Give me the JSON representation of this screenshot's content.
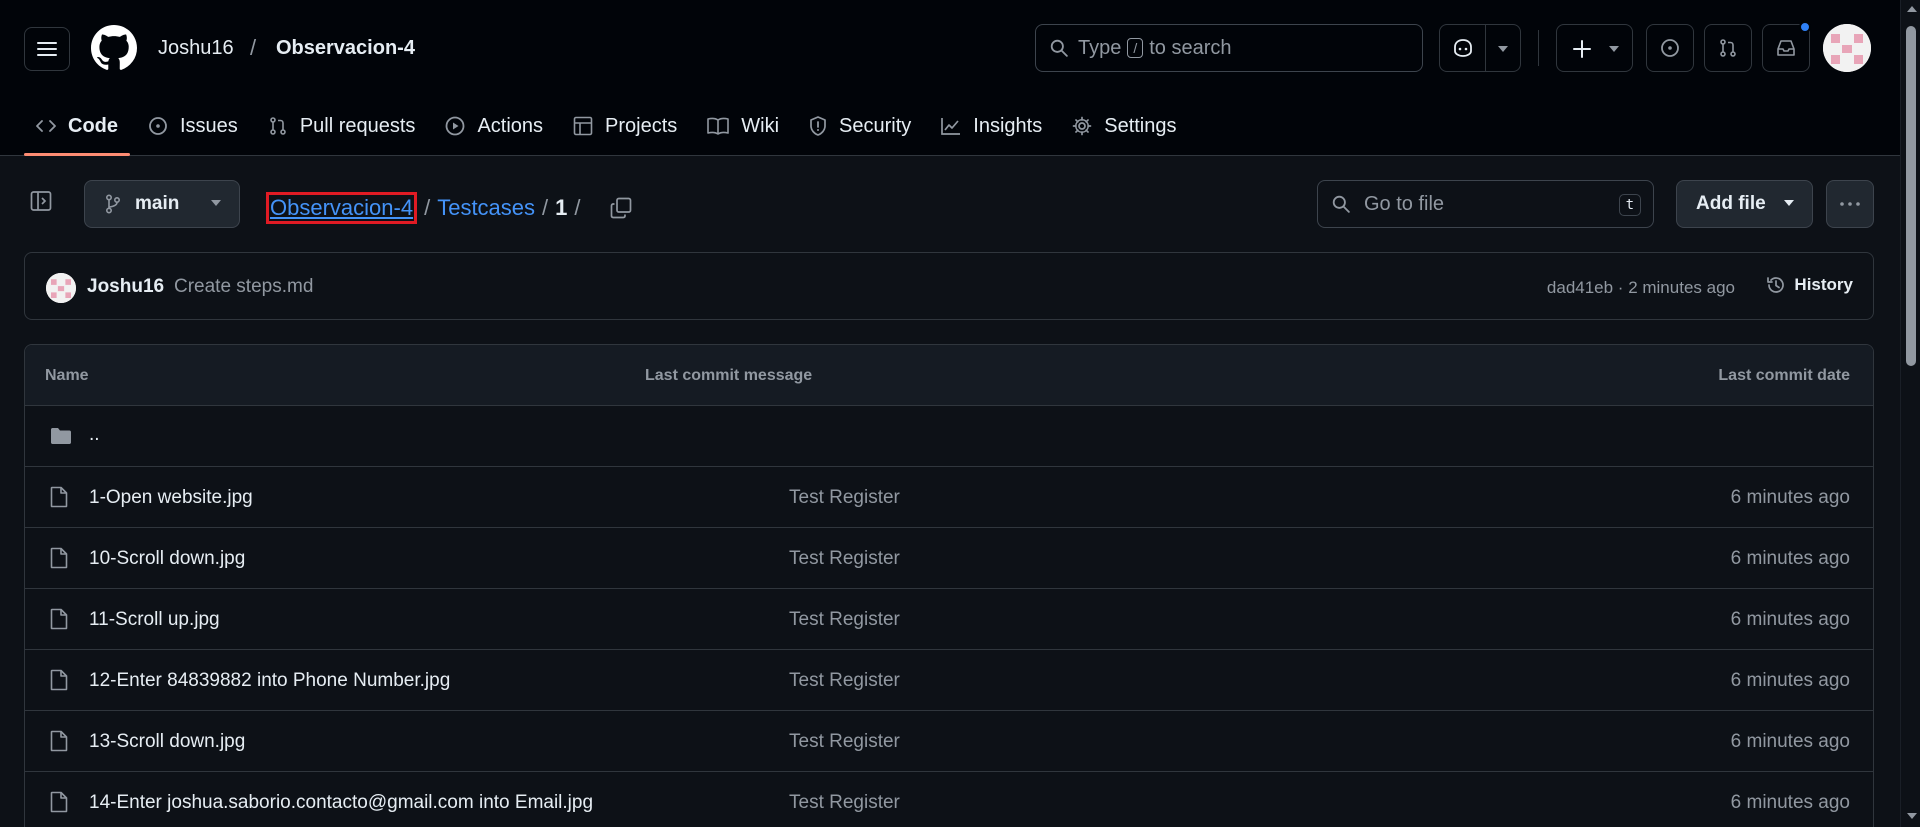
{
  "header": {
    "owner": "Joshu16",
    "separator": "/",
    "repo": "Observacion-4",
    "search_prefix": "Type",
    "search_key": "/",
    "search_suffix": "to search"
  },
  "tabs": [
    {
      "label": "Code",
      "icon": "code-icon",
      "active": true
    },
    {
      "label": "Issues",
      "icon": "issue-opened-icon"
    },
    {
      "label": "Pull requests",
      "icon": "git-pull-request-icon"
    },
    {
      "label": "Actions",
      "icon": "play-icon"
    },
    {
      "label": "Projects",
      "icon": "table-icon"
    },
    {
      "label": "Wiki",
      "icon": "book-icon"
    },
    {
      "label": "Security",
      "icon": "shield-icon"
    },
    {
      "label": "Insights",
      "icon": "graph-icon"
    },
    {
      "label": "Settings",
      "icon": "gear-icon"
    }
  ],
  "toolbar": {
    "branch": "main",
    "breadcrumb": {
      "repo": "Observacion-4",
      "sep1": "/",
      "folder": "Testcases",
      "sep2": "/",
      "current": "1",
      "sep3": "/"
    },
    "go_to_file": "Go to file",
    "go_to_file_key": "t",
    "add_file": "Add file"
  },
  "commit": {
    "author": "Joshu16",
    "message": "Create steps.md",
    "meta": "dad41eb · 2 minutes ago",
    "history": "History"
  },
  "table": {
    "headers": {
      "name": "Name",
      "message": "Last commit message",
      "date": "Last commit date"
    },
    "parent": "..",
    "rows": [
      {
        "name": "1-Open website.jpg",
        "message": "Test Register",
        "date": "6 minutes ago"
      },
      {
        "name": "10-Scroll down.jpg",
        "message": "Test Register",
        "date": "6 minutes ago"
      },
      {
        "name": "11-Scroll up.jpg",
        "message": "Test Register",
        "date": "6 minutes ago"
      },
      {
        "name": "12-Enter 84839882 into Phone Number.jpg",
        "message": "Test Register",
        "date": "6 minutes ago"
      },
      {
        "name": "13-Scroll down.jpg",
        "message": "Test Register",
        "date": "6 minutes ago"
      },
      {
        "name": "14-Enter joshua.saborio.contacto@gmail.com into Email.jpg",
        "message": "Test Register",
        "date": "6 minutes ago"
      }
    ]
  },
  "colors": {
    "background": "#0d1117",
    "header_bg": "#010409",
    "accent_link": "#4493f8",
    "active_tab_underline": "#fd8c73",
    "highlight_box": "#e01b24",
    "notification_dot": "#2f81f7"
  }
}
